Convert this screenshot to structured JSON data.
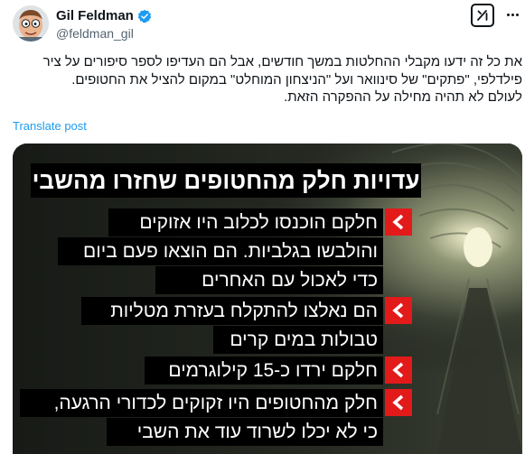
{
  "author": {
    "name": "Gil Feldman",
    "handle": "@feldman_gil"
  },
  "post": {
    "lines": [
      "את כל זה ידעו מקבלי ההחלטות במשך חודשים, אבל הם העדיפו לספר סיפורים על ציר",
      "פילדלפי, \"פתקים\" של סינוואר ועל \"הניצחון המוחלט\" במקום להציל את החטופים.",
      "לעולם לא תהיה מחילה על ההפקרה הזאת."
    ],
    "translate_label": "Translate post"
  },
  "media": {
    "headline": "עדויות חלק מהחטופים שחזרו מהשבי",
    "bullets": [
      {
        "lines": [
          "חלקם הוכנסו לכלוב היו אזוקים",
          "והולבשו בגלביות. הם הוצאו פעם ביום",
          "כדי לאכול עם האחרים"
        ]
      },
      {
        "lines": [
          "הם נאלצו להתקלח בעזרת מטליות",
          "טבולות במים קרים"
        ]
      },
      {
        "lines": [
          "חלקם ירדו כ-15 קילוגרמים"
        ]
      },
      {
        "lines": [
          "חלק מהחטופים היו זקוקים לכדורי הרגעה,",
          "כי לא יכלו לשרוד עוד את השבי"
        ]
      }
    ]
  },
  "colors": {
    "accent_blue": "#1d9bf0",
    "bullet_red": "#e21a1a",
    "text": "#0f1419",
    "secondary_text": "#536471"
  },
  "icons": {
    "verified": "verified-badge-icon",
    "grok": "grok-icon",
    "more": "more-icon",
    "bullet": "chevron-left-icon"
  }
}
